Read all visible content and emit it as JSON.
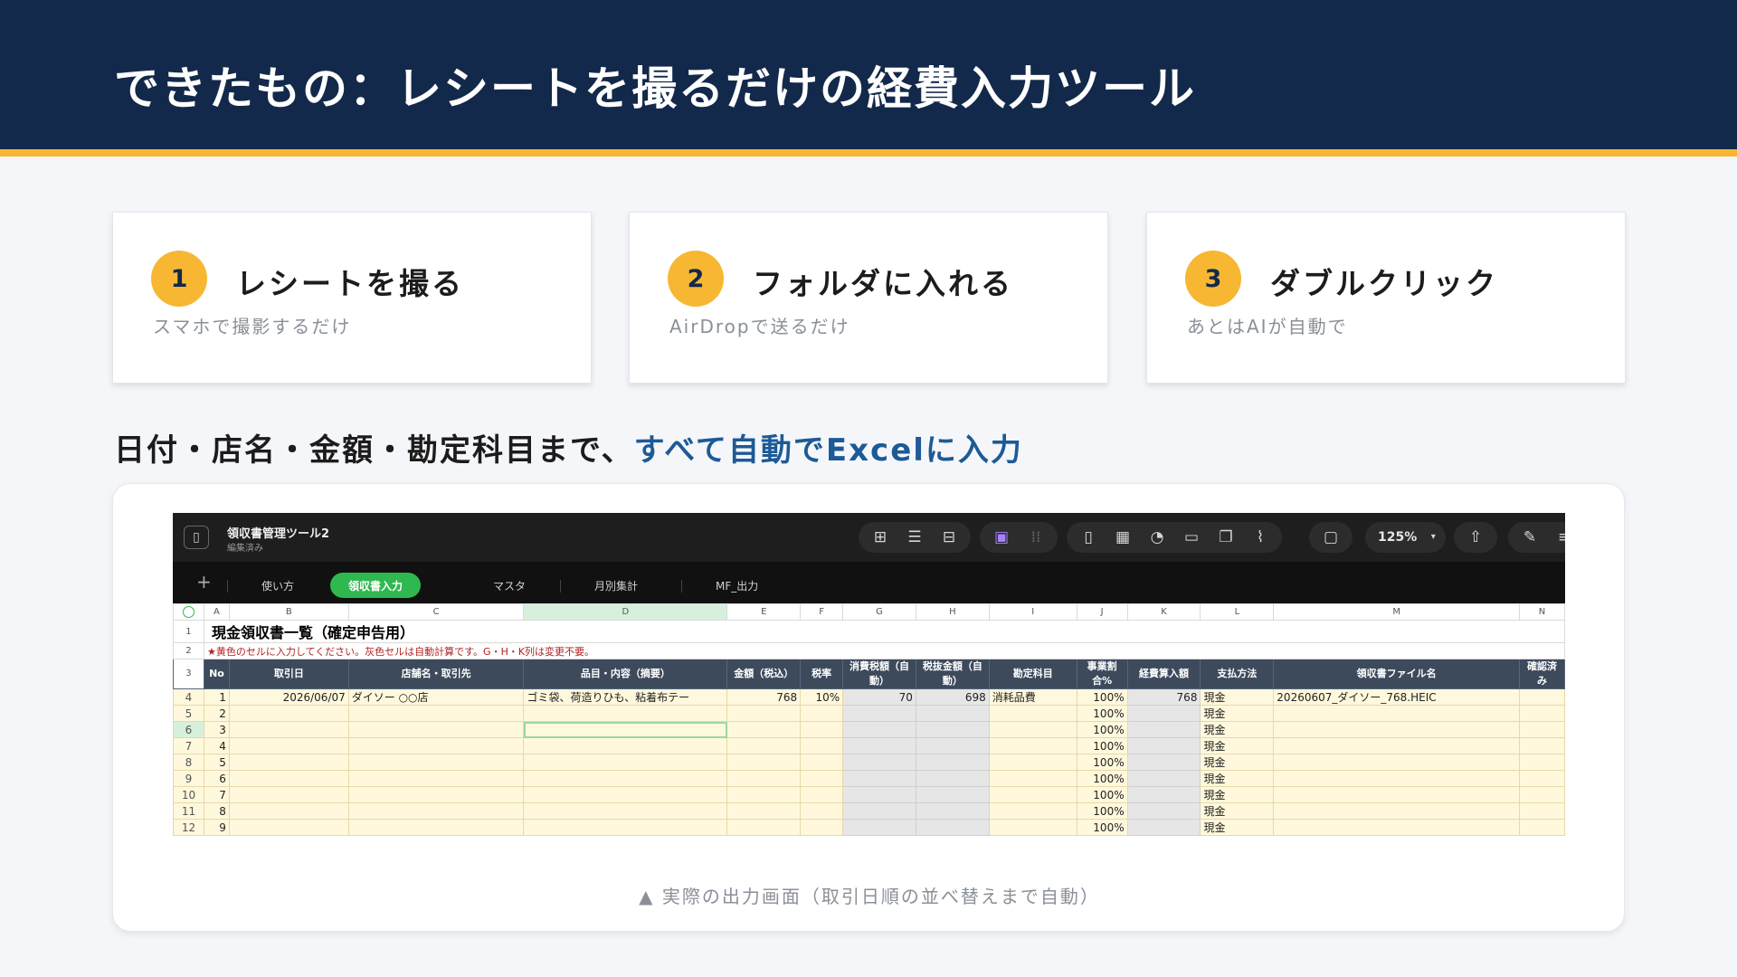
{
  "header": {
    "title": "できたもの：レシートを撮るだけの経費入力ツール"
  },
  "steps": [
    {
      "num": "1",
      "title": "レシートを撮る",
      "sub": "スマホで撮影するだけ"
    },
    {
      "num": "2",
      "title": "フォルダに入れる",
      "sub": "AirDropで送るだけ"
    },
    {
      "num": "3",
      "title": "ダブルクリック",
      "sub": "あとはAIが自動で"
    }
  ],
  "subtitle": {
    "prefix": "日付・店名・金額・勘定科目まで、",
    "highlight": "すべて自動でExcelに入力"
  },
  "caption": "▲ 実際の出力画面（取引日順の並べ替えまで自動）",
  "app": {
    "doc_title": "領収書管理ツール2",
    "doc_status": "編集済み",
    "zoom": "125%",
    "icons": {
      "sidebar": "sidebar-toggle-icon",
      "group1": [
        "add-row-icon",
        "list-icon",
        "table-add-icon"
      ],
      "group2": [
        "media-icon",
        "grid-dots-icon"
      ],
      "group3": [
        "bottle-icon",
        "table-icon",
        "chart-icon",
        "text-box-icon",
        "shapes-icon",
        "attach-icon"
      ],
      "group4": [
        "comment-icon"
      ],
      "group5": [
        "share-icon"
      ],
      "group6": [
        "pin-icon",
        "menu-icon"
      ]
    },
    "tabs": [
      "使い方",
      "領収書入力",
      "マスタ",
      "月別集計",
      "MF_出力"
    ],
    "active_tab": 1,
    "colors": {
      "active_tab": "#2fb84f",
      "header_row": "#3d4a5c",
      "input_cell": "#fff8dc",
      "auto_cell": "#e6e6e6"
    }
  },
  "sheet": {
    "col_letters": [
      "A",
      "B",
      "C",
      "D",
      "E",
      "F",
      "G",
      "H",
      "I",
      "J",
      "K",
      "L",
      "M",
      "N"
    ],
    "row_numbers": [
      "1",
      "2",
      "3",
      "4",
      "5",
      "6",
      "7",
      "8",
      "9",
      "10",
      "11",
      "12"
    ],
    "title": "現金領収書一覧（確定申告用）",
    "note": "★黄色のセルに入力してください。灰色セルは自動計算です。G・H・K列は変更不要。",
    "headers": [
      "No",
      "取引日",
      "店舗名・取引先",
      "品目・内容（摘要）",
      "金額（税込）",
      "税率",
      "消費税額（自動）",
      "税抜金額（自動）",
      "勘定科目",
      "事業割合%",
      "経費算入額",
      "支払方法",
      "領収書ファイル名",
      "確認済み"
    ],
    "first_row": {
      "no": "1",
      "date": "2026/06/07",
      "store": "ダイソー ○○店",
      "item": "ゴミ袋、荷造りひも、粘着布テー",
      "amount": "768",
      "tax_rate": "10%",
      "tax": "70",
      "net": "698",
      "account": "消耗品費",
      "ratio": "100%",
      "expense": "768",
      "payment": "現金",
      "file": "20260607_ダイソー_768.HEIC"
    },
    "other_rows": [
      {
        "no": "2",
        "ratio": "100%",
        "payment": "現金"
      },
      {
        "no": "3",
        "ratio": "100%",
        "payment": "現金"
      },
      {
        "no": "4",
        "ratio": "100%",
        "payment": "現金"
      },
      {
        "no": "5",
        "ratio": "100%",
        "payment": "現金"
      },
      {
        "no": "6",
        "ratio": "100%",
        "payment": "現金"
      },
      {
        "no": "7",
        "ratio": "100%",
        "payment": "現金"
      },
      {
        "no": "8",
        "ratio": "100%",
        "payment": "現金"
      },
      {
        "no": "9",
        "ratio": "100%",
        "payment": "現金"
      }
    ]
  }
}
